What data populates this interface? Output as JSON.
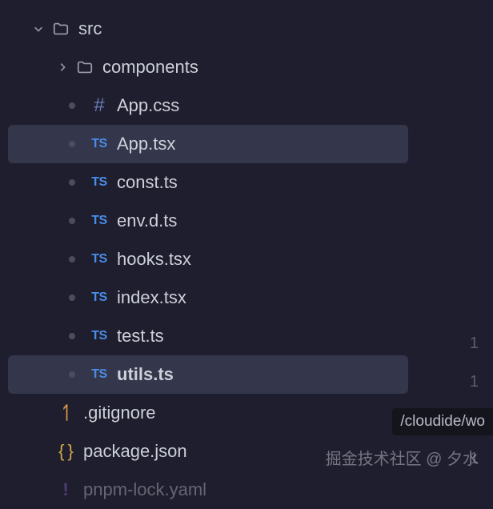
{
  "tree": {
    "root_folder": "src",
    "components_folder": "components",
    "files": {
      "app_css": "App.css",
      "app_tsx": "App.tsx",
      "const_ts": "const.ts",
      "env_d_ts": "env.d.ts",
      "hooks_tsx": "hooks.tsx",
      "index_tsx": "index.tsx",
      "test_ts": "test.ts",
      "utils_ts": "utils.ts"
    },
    "root_files": {
      "gitignore": ".gitignore",
      "package_json": "package.json",
      "pnpm_lock": "pnpm-lock.yaml"
    }
  },
  "line_numbers": {
    "n1": "1",
    "n2": "1",
    "n3": "1"
  },
  "tooltip": "/cloudide/wo",
  "watermark": "掘金技术社区 @ 夕水"
}
